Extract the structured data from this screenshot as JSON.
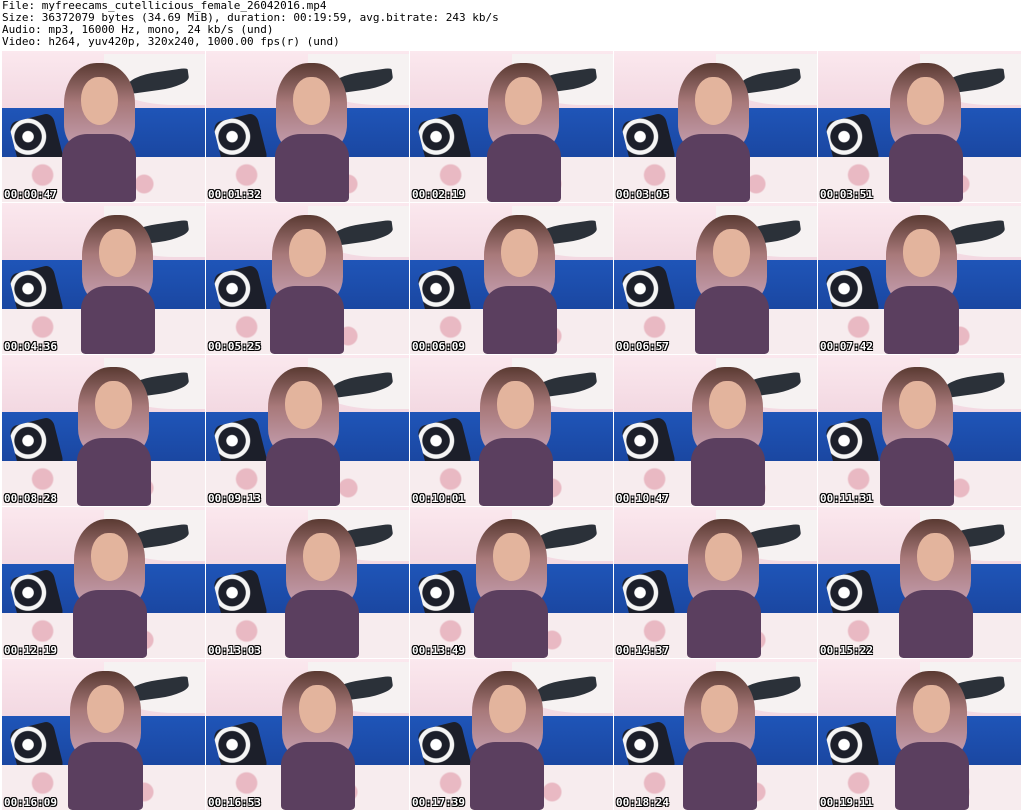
{
  "header": {
    "file_line": "File: myfreecams_cutellicious_female_26042016.mp4",
    "size_line": "Size: 36372079 bytes (34.69 MiB), duration: 00:19:59, avg.bitrate: 243 kb/s",
    "audio_line": "Audio: mp3, 16000 Hz, mono, 24 kb/s (und)",
    "video_line": "Video: h264, yuv420p, 320x240, 1000.00 fps(r) (und)"
  },
  "thumbnails": [
    {
      "timestamp": "00:00:47"
    },
    {
      "timestamp": "00:01:32"
    },
    {
      "timestamp": "00:02:19"
    },
    {
      "timestamp": "00:03:05"
    },
    {
      "timestamp": "00:03:51"
    },
    {
      "timestamp": "00:04:36"
    },
    {
      "timestamp": "00:05:25"
    },
    {
      "timestamp": "00:06:09"
    },
    {
      "timestamp": "00:06:57"
    },
    {
      "timestamp": "00:07:42"
    },
    {
      "timestamp": "00:08:28"
    },
    {
      "timestamp": "00:09:13"
    },
    {
      "timestamp": "00:10:01"
    },
    {
      "timestamp": "00:10:47"
    },
    {
      "timestamp": "00:11:31"
    },
    {
      "timestamp": "00:12:19"
    },
    {
      "timestamp": "00:13:03"
    },
    {
      "timestamp": "00:13:49"
    },
    {
      "timestamp": "00:14:37"
    },
    {
      "timestamp": "00:15:22"
    },
    {
      "timestamp": "00:16:09"
    },
    {
      "timestamp": "00:16:53"
    },
    {
      "timestamp": "00:17:39"
    },
    {
      "timestamp": "00:18:24"
    },
    {
      "timestamp": "00:19:11"
    }
  ]
}
